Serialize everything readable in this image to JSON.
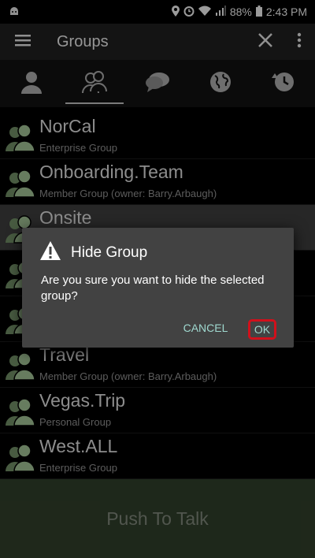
{
  "status_bar": {
    "battery": "88%",
    "time": "2:43 PM",
    "icons": [
      "android-icon",
      "location-icon",
      "alarm-icon",
      "wifi-icon",
      "signal-icon",
      "battery-icon"
    ]
  },
  "app_bar": {
    "title": "Groups",
    "icons": [
      "menu-icon",
      "close-icon",
      "overflow-icon"
    ]
  },
  "tabs": [
    {
      "icon": "person-icon"
    },
    {
      "icon": "group-icon",
      "selected": true
    },
    {
      "icon": "chat-icon"
    },
    {
      "icon": "globe-icon"
    },
    {
      "icon": "history-icon"
    }
  ],
  "groups": [
    {
      "name": "NorCal",
      "type": "Enterprise Group"
    },
    {
      "name": "Onboarding.Team",
      "type": "Member Group (owner: Barry.Arbaugh)"
    },
    {
      "name": "Onsite",
      "type": "",
      "selected": true
    },
    {
      "name": "",
      "type": ""
    },
    {
      "name": "",
      "type": ""
    },
    {
      "name": "Travel",
      "type": "Member Group (owner: Barry.Arbaugh)"
    },
    {
      "name": "Vegas.Trip",
      "type": "Personal Group"
    },
    {
      "name": "West.ALL",
      "type": "Enterprise Group"
    }
  ],
  "push_to_talk": {
    "label": "Push To Talk"
  },
  "dialog": {
    "title": "Hide Group",
    "message": "Are you sure you want to hide the selected group?",
    "cancel_label": "CANCEL",
    "ok_label": "OK",
    "icon": "warning-icon"
  },
  "colors": {
    "accent_text": "#9fd8cf",
    "highlight": "#d1101b",
    "ptt_background": "#2f3e2a",
    "avatar_green": "#9fbf93"
  }
}
